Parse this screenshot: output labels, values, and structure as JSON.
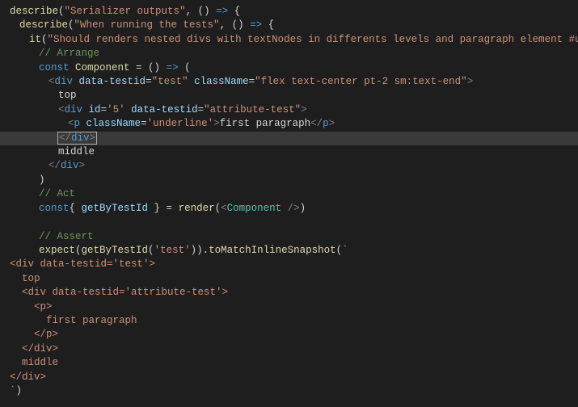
{
  "code": {
    "l1": {
      "fn": "describe",
      "s": "\"Serializer outputs\"",
      "arrow": ", () "
    },
    "l2": {
      "fn": "describe",
      "s": "\"When running the tests\"",
      "arrow": ", () "
    },
    "l3": {
      "fn": "it",
      "s": "\"Should renders nested divs with textNodes in differents levels and paragraph element #unit\"",
      "arrow": ", () "
    },
    "l4": "// Arrange",
    "l5": {
      "kw": "const",
      "v": "Component",
      "arrow": " = () "
    },
    "l6": {
      "tag": "div",
      "a1": "data-testid",
      "v1": "\"test\"",
      "a2": "className",
      "v2": "\"flex text-center pt-2 sm:text-end\""
    },
    "l7": "top",
    "l8": {
      "tag": "div",
      "a1": "id",
      "v1": "'5'",
      "a2": "data-testid",
      "v2": "\"attribute-test\""
    },
    "l9": {
      "tag": "p",
      "a1": "className",
      "v1": "'underline'",
      "txt": "first paragraph"
    },
    "l10": "</div>",
    "l11": "middle",
    "l12": "</div>",
    "l13": ")",
    "l14": "// Act",
    "l15": {
      "kw": "const",
      "d": "{ ",
      "v": "getByTestId",
      "d2": " } = ",
      "fn": "render",
      "tag": "Component"
    },
    "l16": "// Assert",
    "l17": {
      "fn": "expect",
      "fn2": "getByTestId",
      "s": "'test'",
      "fn3": "toMatchInlineSnapshot"
    },
    "l18": "<div data-testid='test'>",
    "l19": "  top",
    "l20": "  <div data-testid='attribute-test'>",
    "l21": "    <p>",
    "l22": "      first paragraph",
    "l23": "    </p>",
    "l24": "  </div>",
    "l25": "  middle",
    "l26": "</div>",
    "l27": "`)"
  }
}
